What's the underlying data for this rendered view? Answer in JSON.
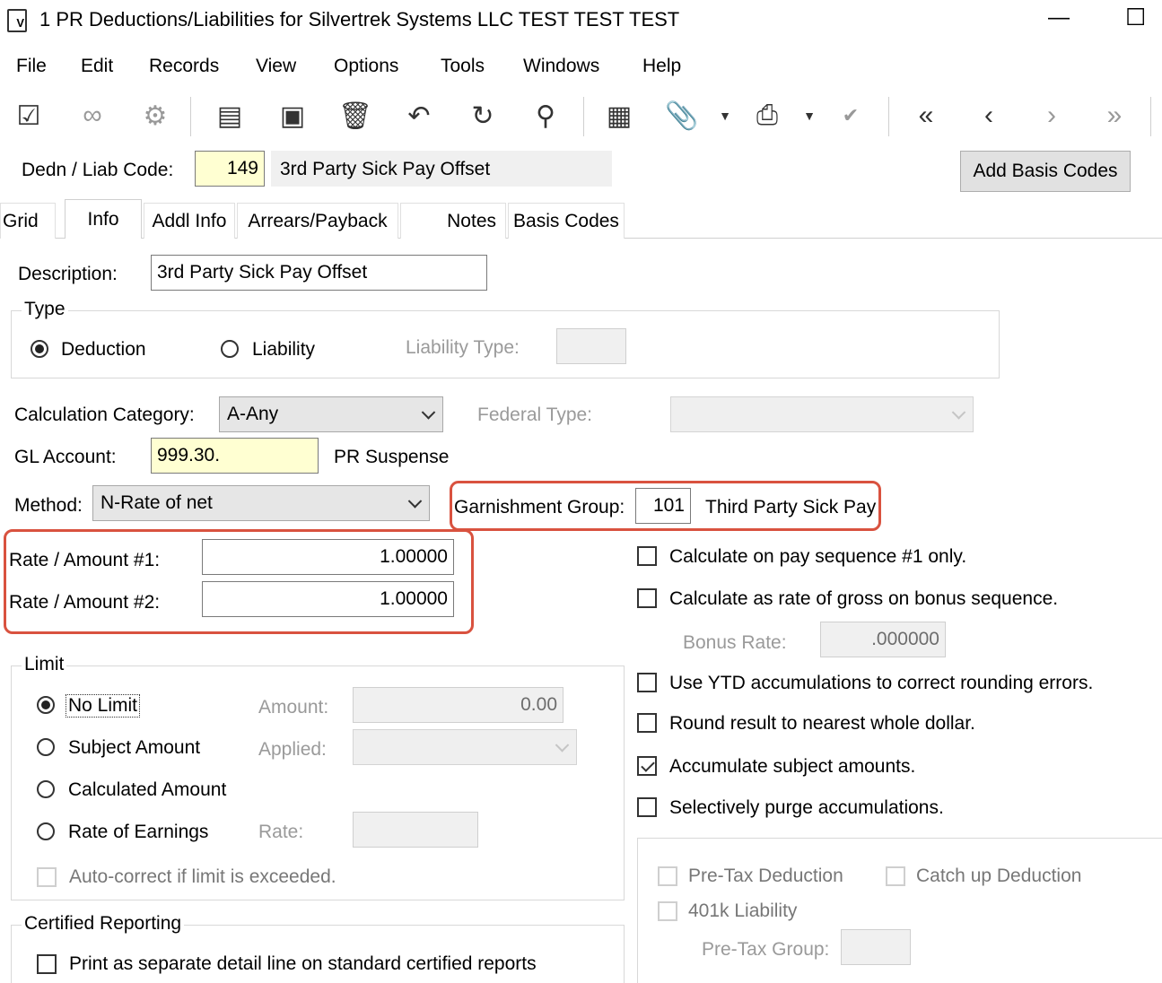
{
  "window": {
    "title": "1 PR Deductions/Liabilities for Silvertrek Systems LLC TEST TEST TEST",
    "minimize_glyph": "—",
    "maximize_glyph": "☐"
  },
  "menu": [
    "File",
    "Edit",
    "Records",
    "View",
    "Options",
    "Tools",
    "Windows",
    "Help"
  ],
  "toolbar": {
    "icons": [
      "checklist-icon",
      "binoculars-icon",
      "gear-check-icon",
      "new-document-icon",
      "save-icon",
      "delete-icon",
      "undo-icon",
      "refresh-icon",
      "search-icon",
      "calculator-icon",
      "attachment-icon",
      "print-icon",
      "spellcheck-icon",
      "first-record-icon",
      "previous-record-icon",
      "next-record-icon",
      "last-record-icon"
    ]
  },
  "header": {
    "code_label": "Dedn / Liab Code:",
    "code_value": "149",
    "code_description": "3rd Party Sick Pay Offset",
    "add_basis_button": "Add Basis Codes"
  },
  "tabs": [
    {
      "label": "Grid",
      "active": false
    },
    {
      "label": "Info",
      "active": true
    },
    {
      "label": "Addl Info",
      "active": false
    },
    {
      "label": "Arrears/Payback",
      "active": false
    },
    {
      "label": "Notes",
      "active": false
    },
    {
      "label": "Basis Codes",
      "active": false
    }
  ],
  "form": {
    "description_label": "Description:",
    "description_value": "3rd Party Sick Pay Offset",
    "type_group": "Type",
    "type_deduction": "Deduction",
    "type_liability": "Liability",
    "liability_type_label": "Liability Type:",
    "calc_category_label": "Calculation Category:",
    "calc_category_value": "A-Any",
    "federal_type_label": "Federal Type:",
    "gl_account_label": "GL Account:",
    "gl_account_value": "999.30.",
    "gl_account_desc": "PR Suspense",
    "method_label": "Method:",
    "method_value": "N-Rate of net",
    "garnishment_label": "Garnishment Group:",
    "garnishment_value": "101",
    "garnishment_desc": "Third Party Sick Pay",
    "rate1_label": "Rate / Amount #1:",
    "rate1_value": "1.00000",
    "rate2_label": "Rate / Amount #2:",
    "rate2_value": "1.00000"
  },
  "limit": {
    "group": "Limit",
    "no_limit": "No Limit",
    "subject_amount": "Subject Amount",
    "calculated_amount": "Calculated Amount",
    "rate_of_earnings": "Rate of Earnings",
    "amount_label": "Amount:",
    "amount_value": "0.00",
    "applied_label": "Applied:",
    "rate_label": "Rate:",
    "autocorrect": "Auto-correct if limit is exceeded."
  },
  "certified": {
    "group": "Certified Reporting",
    "print_separate": "Print as separate detail line on standard certified reports"
  },
  "options": {
    "pay_seq1": "Calculate on pay sequence #1 only.",
    "rate_gross_bonus": "Calculate as rate of gross on bonus sequence.",
    "bonus_rate_label": "Bonus Rate:",
    "bonus_rate_value": ".000000",
    "ytd": "Use YTD accumulations to correct rounding errors.",
    "round_dollar": "Round result to nearest whole dollar.",
    "accumulate": "Accumulate subject amounts.",
    "purge": "Selectively purge accumulations.",
    "pretax": "Pre-Tax Deduction",
    "catchup": "Catch up Deduction",
    "liability401k": "401k Liability",
    "pretax_group_label": "Pre-Tax Group:"
  }
}
